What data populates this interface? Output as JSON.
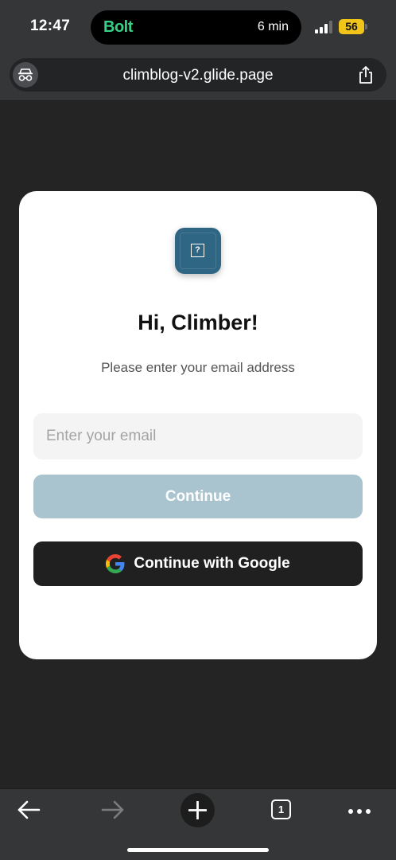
{
  "status_bar": {
    "time": "12:47",
    "island_app": "Bolt",
    "island_text": "6 min",
    "battery": "56"
  },
  "browser": {
    "url": "climblog-v2.glide.page"
  },
  "login": {
    "title": "Hi, Climber!",
    "subtitle": "Please enter your email address",
    "email_placeholder": "Enter your email",
    "email_value": "",
    "continue_label": "Continue",
    "google_label": "Continue with Google"
  },
  "toolbar": {
    "tab_count": "1"
  },
  "icons": {
    "incognito": "incognito-icon",
    "share": "share-icon",
    "back": "arrow-left-icon",
    "forward": "arrow-right-icon",
    "new_tab": "plus-icon",
    "tabs": "tabs-icon",
    "more": "more-dots-icon",
    "google": "google-logo-icon",
    "app": "app-icon"
  },
  "colors": {
    "accent_disabled": "#a9c3cf",
    "app_icon": "#2f6684",
    "bolt_green": "#34d186",
    "battery": "#f0c419",
    "google_button": "#202020"
  }
}
